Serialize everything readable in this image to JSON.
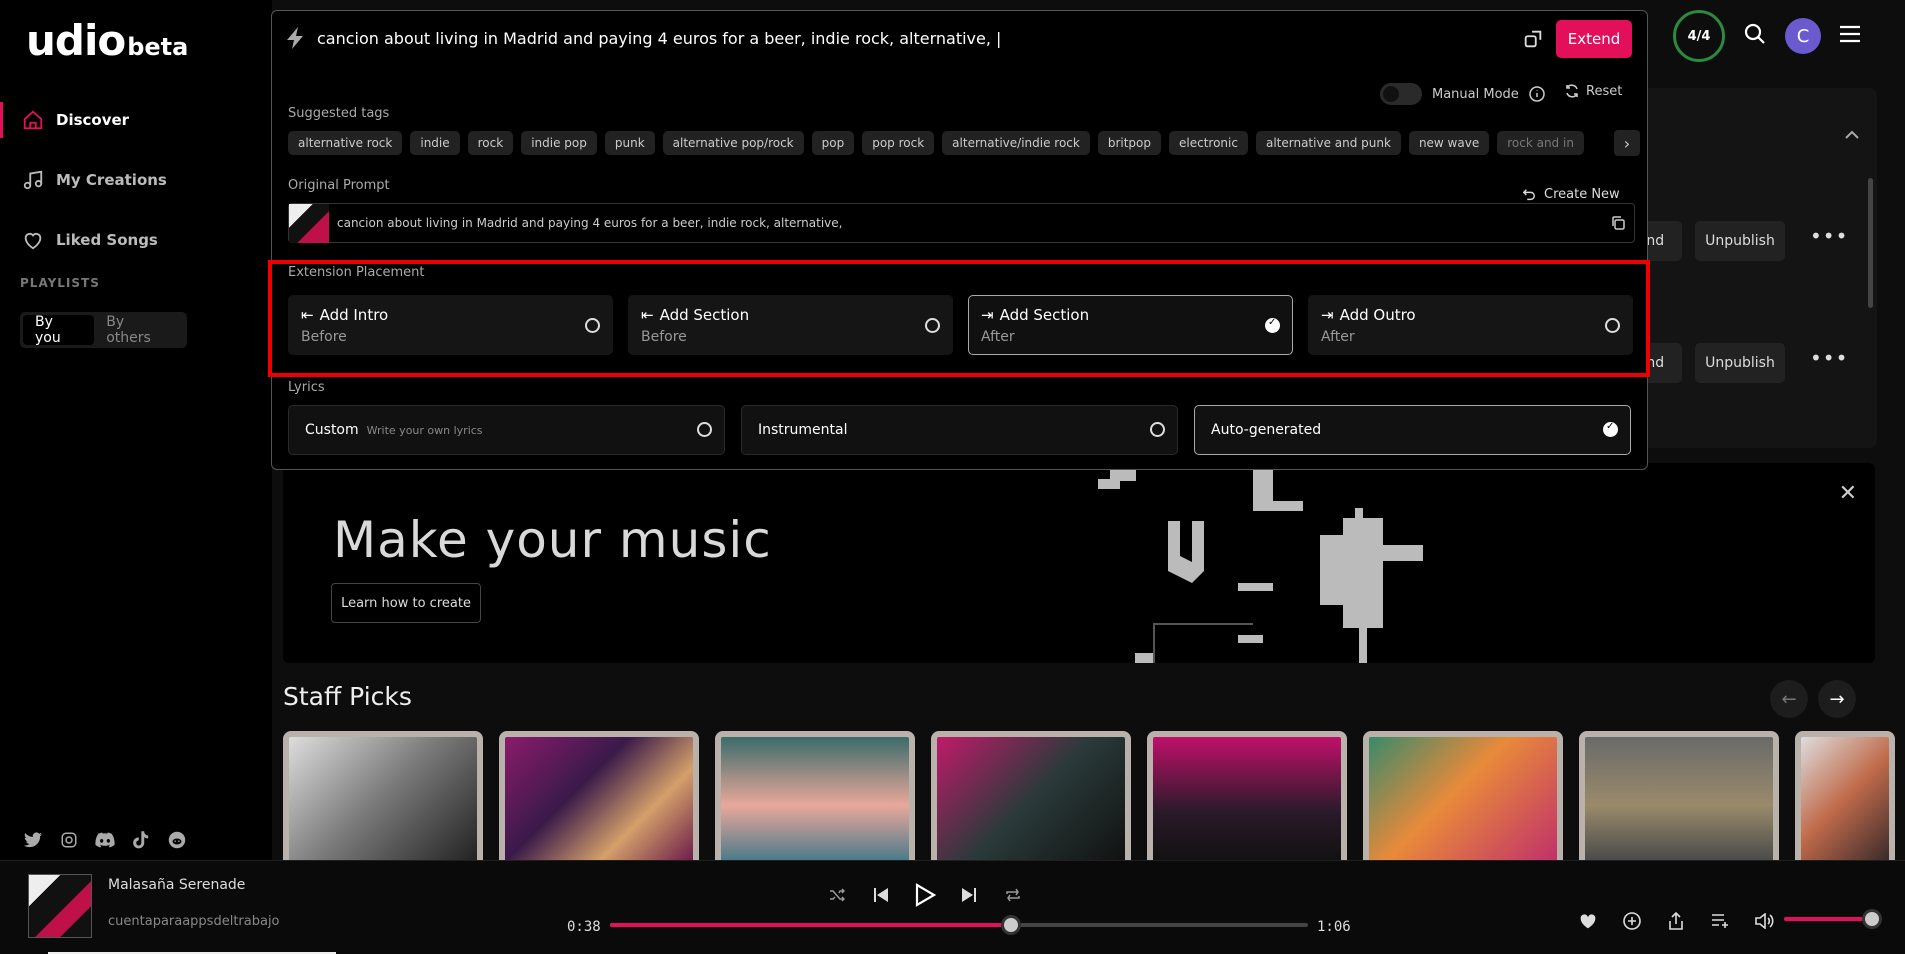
{
  "logo": {
    "main": "udio",
    "suffix": "beta"
  },
  "nav": {
    "discover": "Discover",
    "my_creations": "My Creations",
    "liked": "Liked Songs"
  },
  "playlists": {
    "label": "PLAYLISTS",
    "by_you": "By you",
    "by_others": "By others"
  },
  "prompt": {
    "text": "cancion about living in Madrid and paying 4 euros for a beer, indie rock, alternative, |",
    "extend": "Extend",
    "manual_mode": "Manual Mode",
    "reset": "Reset",
    "suggested_label": "Suggested tags",
    "tags": [
      "alternative rock",
      "indie",
      "rock",
      "indie pop",
      "punk",
      "alternative pop/rock",
      "pop",
      "pop rock",
      "alternative/indie rock",
      "britpop",
      "electronic",
      "alternative and punk",
      "new wave",
      "rock and in"
    ],
    "original_label": "Original Prompt",
    "create_new": "Create New",
    "original_text": "cancion about living in Madrid and paying 4 euros for a beer, indie rock, alternative,",
    "placement_label": "Extension Placement",
    "placements": [
      {
        "title": "Add Intro",
        "sub": "Before",
        "selected": false
      },
      {
        "title": "Add Section",
        "sub": "Before",
        "selected": false
      },
      {
        "title": "Add Section",
        "sub": "After",
        "selected": true
      },
      {
        "title": "Add Outro",
        "sub": "After",
        "selected": false
      }
    ],
    "lyrics_label": "Lyrics",
    "lyrics": {
      "custom": "Custom",
      "custom_hint": "Write your own lyrics",
      "instrumental": "Instrumental",
      "auto": "Auto-generated"
    }
  },
  "header": {
    "credits": "4/4",
    "avatar": "C"
  },
  "bg": {
    "extend": "end",
    "unpublish": "Unpublish"
  },
  "banner": {
    "title": "Make your music",
    "learn": "Learn how to create"
  },
  "staff": {
    "title": "Staff Picks"
  },
  "player": {
    "title": "Malasaña Serenade",
    "artist": "cuentaparaappsdeltrabajo",
    "current": "0:38",
    "total": "1:06",
    "progress": 0.575
  },
  "colors": {
    "accent": "#e30f5a",
    "credit_ring": "#2b8a3e"
  }
}
